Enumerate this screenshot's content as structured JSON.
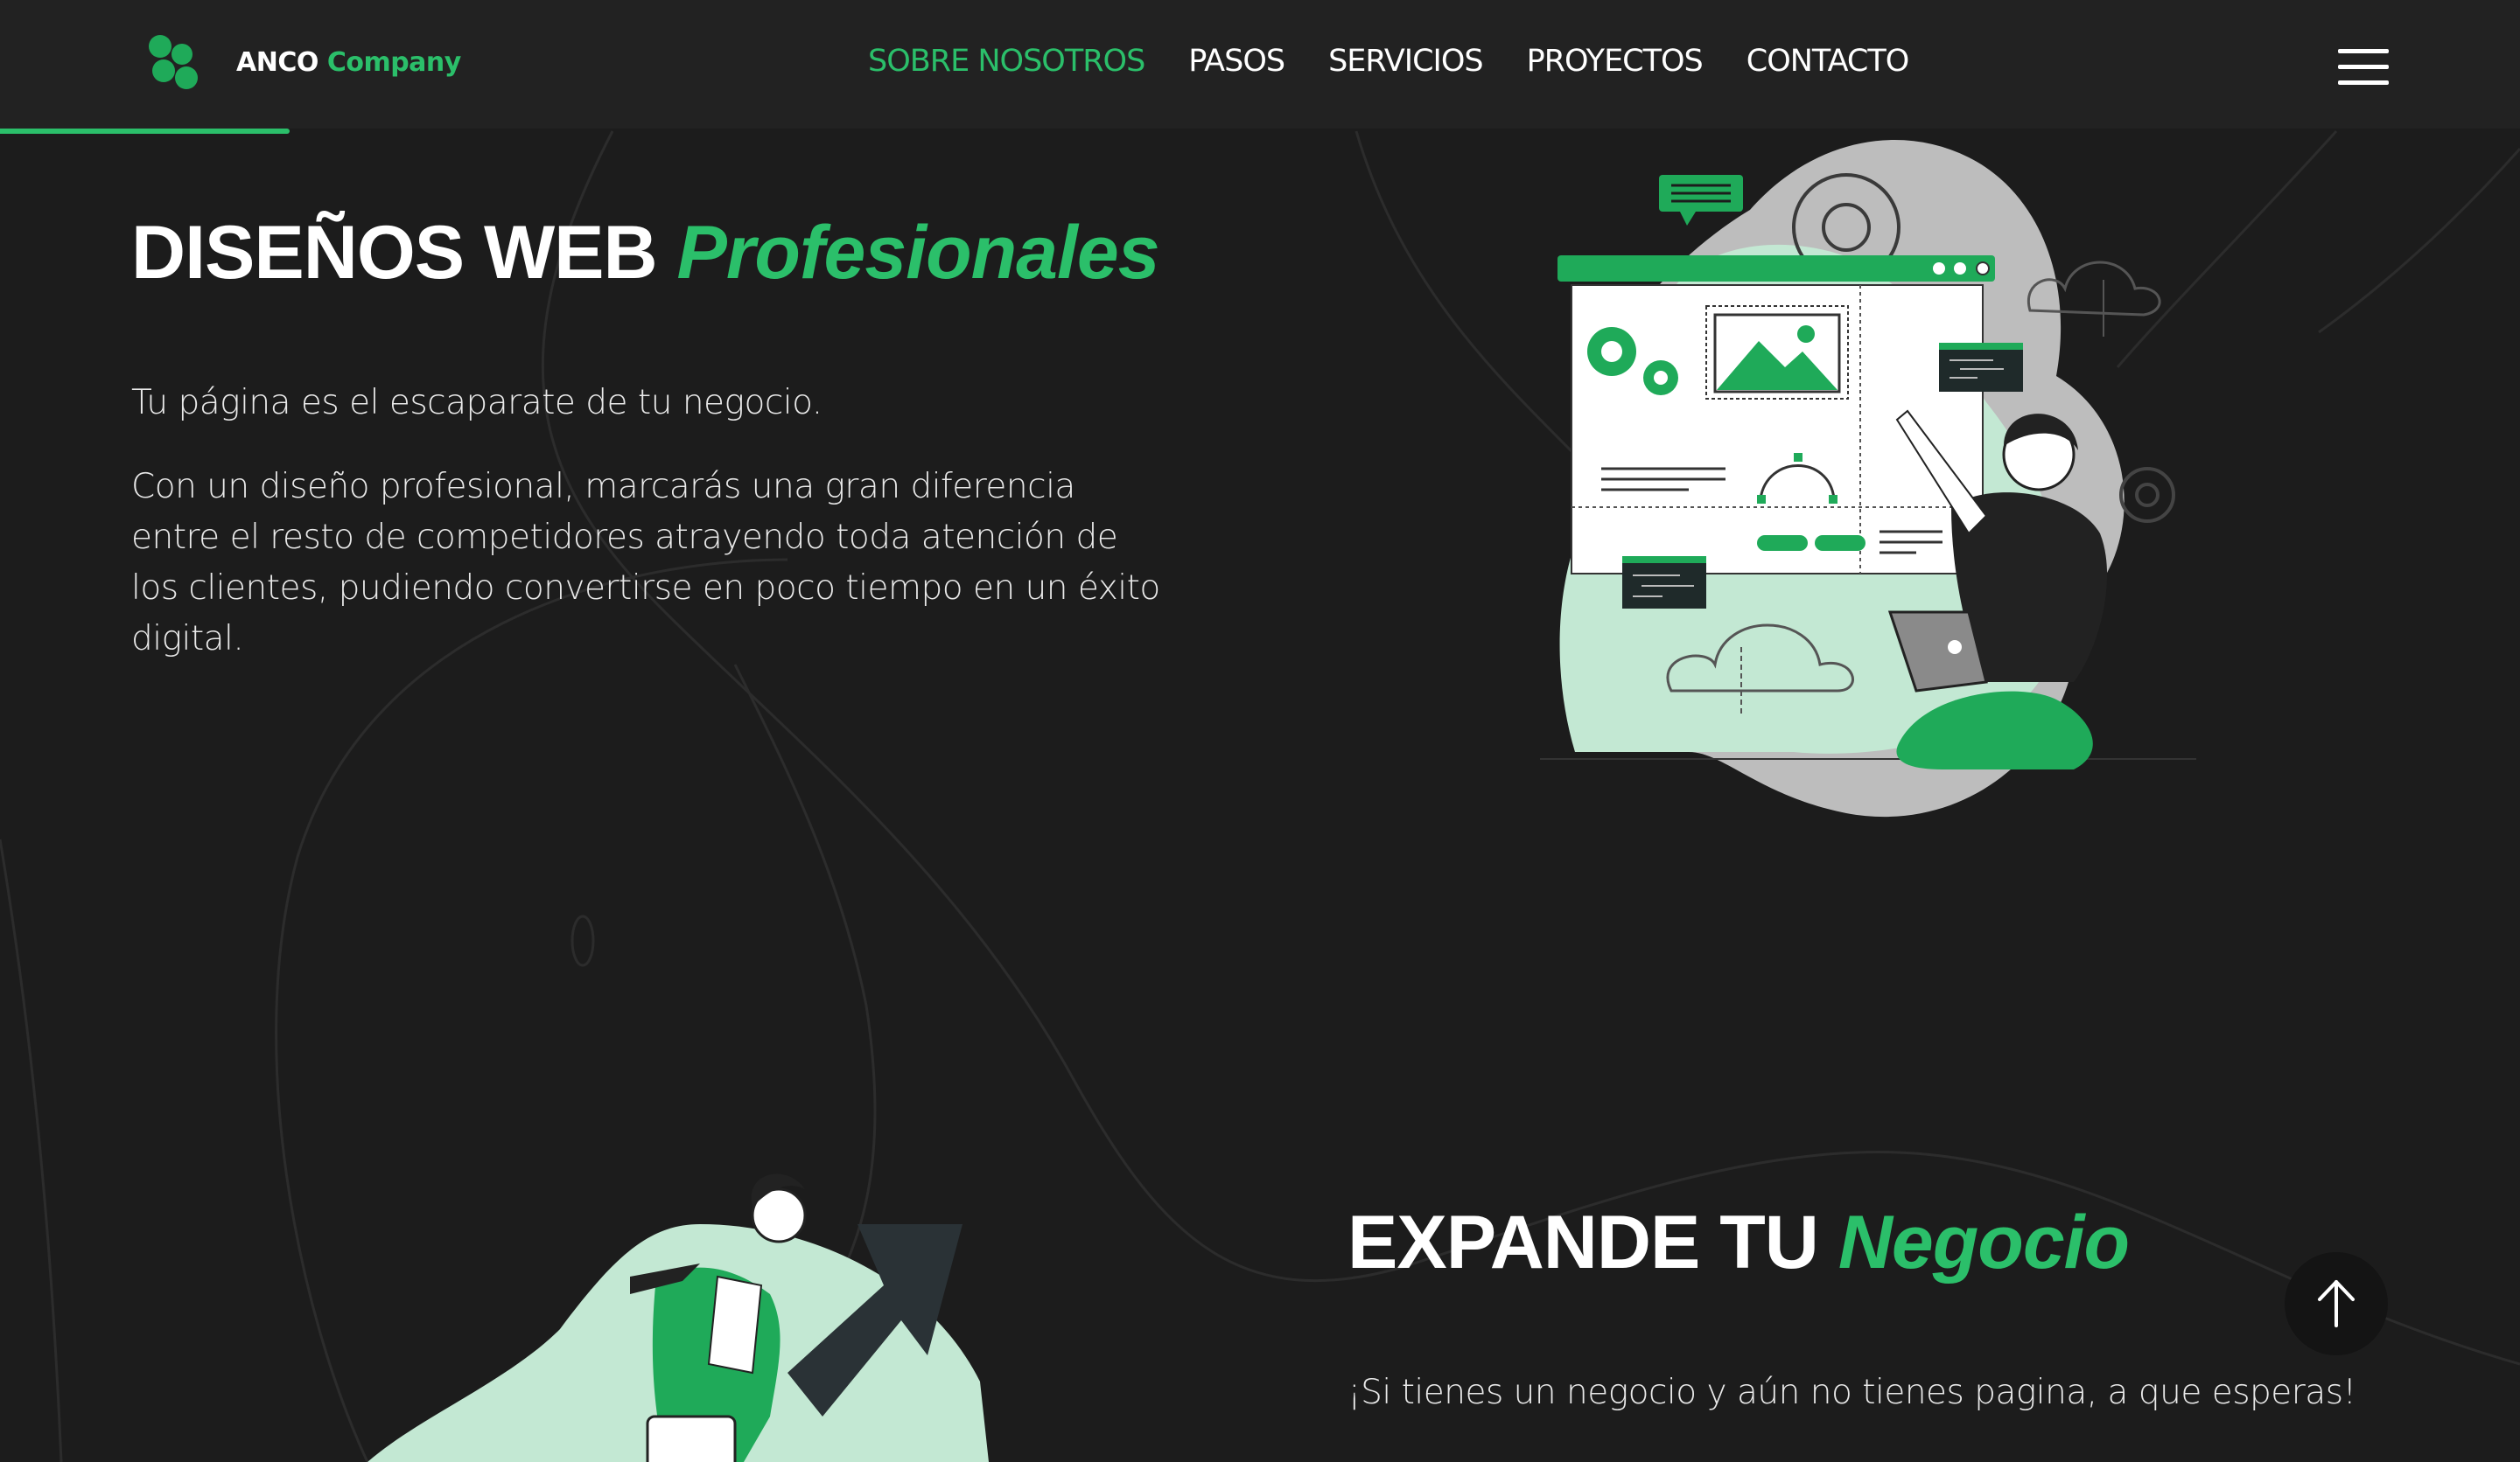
{
  "header": {
    "brand": {
      "name": "ANCO",
      "suffix": "Company"
    },
    "nav": [
      {
        "label": "SOBRE NOSOTROS",
        "active": true
      },
      {
        "label": "PASOS",
        "active": false
      },
      {
        "label": "SERVICIOS",
        "active": false
      },
      {
        "label": "PROYECTOS",
        "active": false
      },
      {
        "label": "CONTACTO",
        "active": false
      }
    ],
    "menu_icon": "hamburger-icon",
    "scroll_progress": 0.115
  },
  "section_web": {
    "title": "DISEÑOS WEB",
    "title_accent": "Profesionales",
    "intro": "Tu página es el escaparate de tu negocio.",
    "body": "Con un diseño profesional, marcarás una gran diferencia entre el resto de competidores atrayendo toda atención de los clientes, pudiendo convertirse en poco tiempo en un éxito digital."
  },
  "section_business": {
    "title": "EXPANDE TU",
    "title_accent": "Negocio",
    "intro": "¡Si tienes un negocio y aún no tienes pagina, a que esperas!"
  },
  "scroll_top": {
    "icon": "arrow-up-icon"
  },
  "colors": {
    "accent": "#2bbf6a",
    "background": "#1c1c1c",
    "navbar": "#222222",
    "mint": "#c3e8d3"
  }
}
